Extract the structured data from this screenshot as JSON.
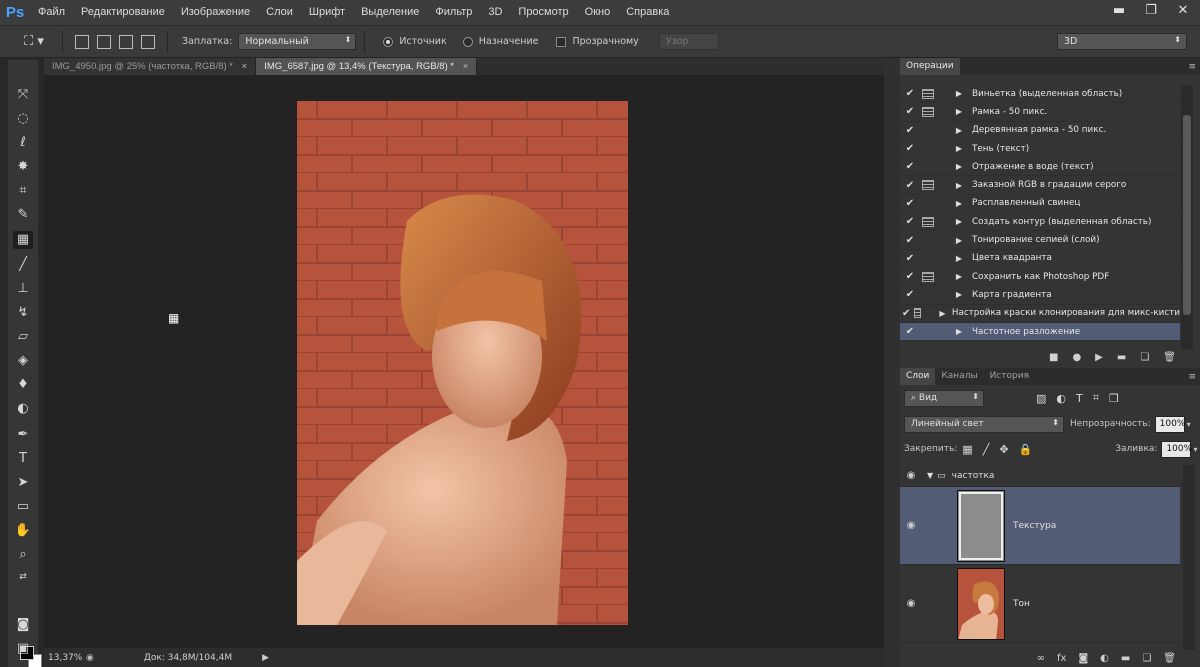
{
  "app": {
    "logo": "Ps"
  },
  "menu": [
    "Файл",
    "Редактирование",
    "Изображение",
    "Слои",
    "Шрифт",
    "Выделение",
    "Фильтр",
    "3D",
    "Просмотр",
    "Окно",
    "Справка"
  ],
  "window_controls": {
    "minimize": "▬",
    "restore": "❐",
    "close": "✕"
  },
  "options": {
    "patch_label": "Заплатка:",
    "patch_mode": "Нормальный",
    "source_label": "Источник",
    "destination_label": "Назначение",
    "transparent_label": "Прозрачному",
    "pattern_label": "Узор",
    "workspace": "3D"
  },
  "tabs": [
    {
      "label": "IMG_4950.jpg @ 25% (частотка, RGB/8) *",
      "close": "×"
    },
    {
      "label": "IMG_6587.jpg @ 13,4% (Текстура, RGB/8) *",
      "close": "×"
    }
  ],
  "status": {
    "zoom": "13,37%",
    "doc": "Док: 34,8M/104,4M"
  },
  "actions_panel": {
    "tab": "Операции",
    "items": [
      {
        "name": "Виньетка (выделенная область)",
        "dialog": true
      },
      {
        "name": "Рамка - 50 пикс.",
        "dialog": true
      },
      {
        "name": "Деревянная рамка - 50 пикс.",
        "dialog": false
      },
      {
        "name": "Тень (текст)",
        "dialog": false
      },
      {
        "name": "Отражение в воде (текст)",
        "dialog": false
      },
      {
        "name": "Заказной RGB в градации серого",
        "dialog": true
      },
      {
        "name": "Расплавленный свинец",
        "dialog": false
      },
      {
        "name": "Создать контур (выделенная область)",
        "dialog": true
      },
      {
        "name": "Тонирование сепией (слой)",
        "dialog": false
      },
      {
        "name": "Цвета квадранта",
        "dialog": false
      },
      {
        "name": "Сохранить как Photoshop PDF",
        "dialog": true
      },
      {
        "name": "Карта градиента",
        "dialog": false
      },
      {
        "name": "Настройка краски клонирования для микс-кисти",
        "dialog": true
      },
      {
        "name": "Частотное разложение",
        "dialog": false,
        "selected": true
      }
    ]
  },
  "layers_panel": {
    "tabs": [
      "Слои",
      "Каналы",
      "История"
    ],
    "filter": "Вид",
    "blend_mode": "Линейный свет",
    "opacity_label": "Непрозрачность:",
    "opacity": "100%",
    "lock_label": "Закрепить:",
    "fill_label": "Заливка:",
    "fill": "100%",
    "group": "частотка",
    "layers": [
      {
        "name": "Текстура",
        "selected": true
      },
      {
        "name": "Тон",
        "selected": false
      }
    ]
  }
}
